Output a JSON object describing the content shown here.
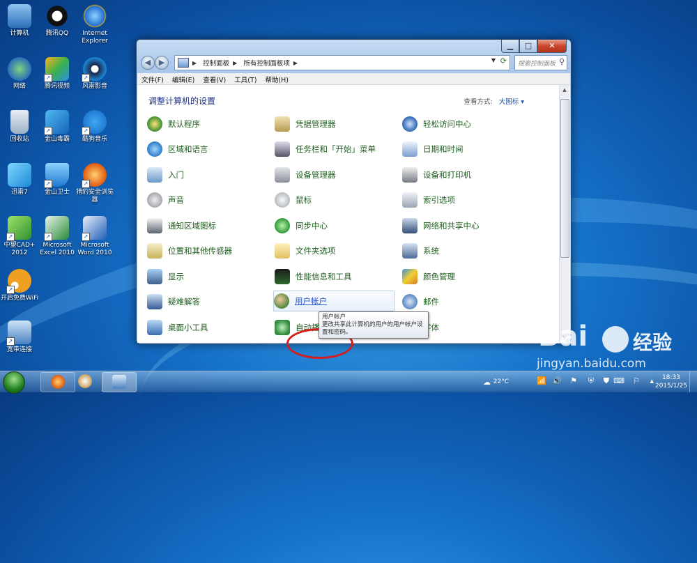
{
  "desktop": {
    "icons": [
      {
        "label": "计算机"
      },
      {
        "label": "腾讯QQ"
      },
      {
        "label": "Internet Explorer"
      },
      {
        "label": "网络"
      },
      {
        "label": "腾讯视频"
      },
      {
        "label": "风雷影音"
      },
      {
        "label": "回收站"
      },
      {
        "label": "金山毒霸"
      },
      {
        "label": "酷狗音乐"
      },
      {
        "label": "迅雷7"
      },
      {
        "label": "金山卫士"
      },
      {
        "label": "猎豹安全浏览器"
      },
      {
        "label": "中望CAD+ 2012"
      },
      {
        "label": "Microsoft Excel 2010"
      },
      {
        "label": "Microsoft Word 2010"
      },
      {
        "label": "开启免费WiFi"
      },
      {
        "label": "宽带连接"
      }
    ]
  },
  "window": {
    "breadcrumb": [
      "控制面板",
      "所有控制面板项"
    ],
    "search_placeholder": "搜索控制面板",
    "menus": [
      "文件(F)",
      "编辑(E)",
      "查看(V)",
      "工具(T)",
      "帮助(H)"
    ],
    "heading": "调整计算机的设置",
    "view_by_label": "查看方式:",
    "view_by_value": "大图标 ▾",
    "items": [
      {
        "label": "默认程序",
        "color": "#3a8f2f"
      },
      {
        "label": "凭据管理器",
        "color": "#b89a52"
      },
      {
        "label": "轻松访问中心",
        "color": "#2b63b5"
      },
      {
        "label": "区域和语言",
        "color": "#2f7cc8"
      },
      {
        "label": "任务栏和「开始」菜单",
        "color": "#556"
      },
      {
        "label": "日期和时间",
        "color": "#7aa0d0"
      },
      {
        "label": "入门",
        "color": "#6a98c8"
      },
      {
        "label": "设备管理器",
        "color": "#8a8f99"
      },
      {
        "label": "设备和打印机",
        "color": "#777c86"
      },
      {
        "label": "声音",
        "color": "#a4a8ae"
      },
      {
        "label": "鼠标",
        "color": "#b8bcc2"
      },
      {
        "label": "索引选项",
        "color": "#9aa4b3"
      },
      {
        "label": "通知区域图标",
        "color": "#5b6470"
      },
      {
        "label": "同步中心",
        "color": "#2f9a37"
      },
      {
        "label": "网络和共享中心",
        "color": "#34507a"
      },
      {
        "label": "位置和其他传感器",
        "color": "#c8b25a"
      },
      {
        "label": "文件夹选项",
        "color": "#e0c060"
      },
      {
        "label": "系统",
        "color": "#4b6a95"
      },
      {
        "label": "显示",
        "color": "#3d5f8c"
      },
      {
        "label": "性能信息和工具",
        "color": "#2e6a2e"
      },
      {
        "label": "颜色管理",
        "color": "#d47a2a"
      },
      {
        "label": "疑难解答",
        "color": "#345a94"
      },
      {
        "label": "用户帐户",
        "color": "#4e8a3c"
      },
      {
        "label": "邮件",
        "color": "#5a87c4"
      },
      {
        "label": "桌面小工具",
        "color": "#3a6fb0"
      },
      {
        "label": "自动播放",
        "color": "#2f8a3a"
      },
      {
        "label": "字体",
        "color": "#d9b13a"
      }
    ],
    "tooltip": {
      "title": "用户帐户",
      "text": "更改共享此计算机的用户的用户帐户设置和密码。"
    }
  },
  "taskbar": {
    "temperature": "22°C",
    "time": "18:33",
    "date": "2015/1/25"
  },
  "watermark": {
    "brand": "Bai",
    "brand2": "经验",
    "url": "jingyan.baidu.com"
  }
}
